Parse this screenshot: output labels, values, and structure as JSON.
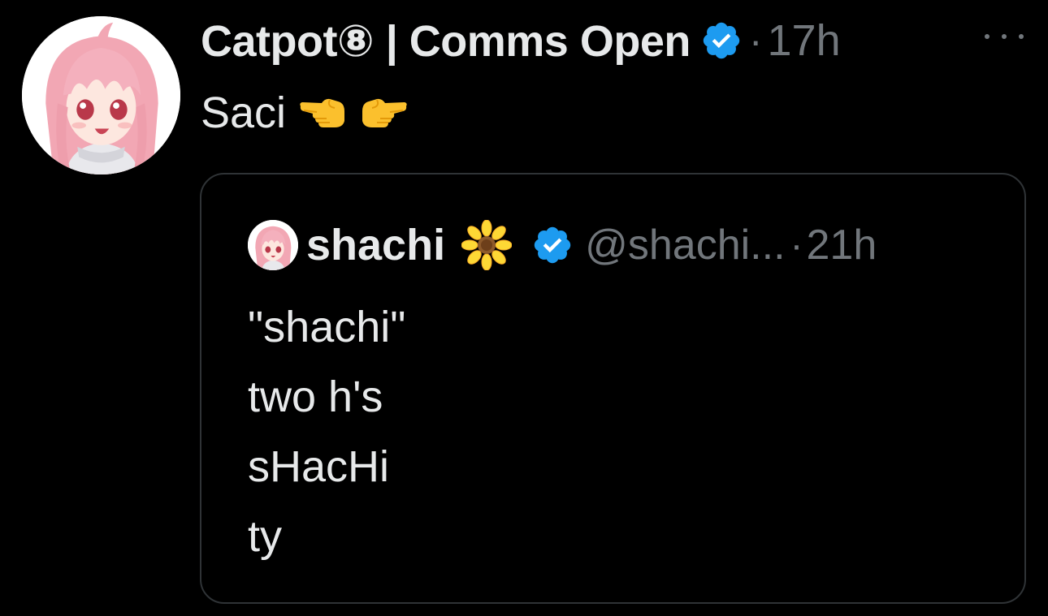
{
  "tweet": {
    "display_name": "Catpot⑧ | Comms Open",
    "separator": "·",
    "time": "17h",
    "text": "Saci",
    "emojis": [
      "backhand-index-pointing-left",
      "backhand-index-pointing-right"
    ]
  },
  "quoted_tweet": {
    "display_name": "shachi",
    "name_emoji": "sunflower",
    "handle": "@shachi...",
    "separator": "·",
    "time": "21h",
    "lines": [
      "\"shachi\"",
      "two h's",
      "sHacHi",
      "ty"
    ]
  },
  "colors": {
    "background": "#000000",
    "primary_text": "#e7e9ea",
    "secondary_text": "#71767b",
    "verified_blue": "#1d9bf0",
    "border": "#2f3336"
  }
}
